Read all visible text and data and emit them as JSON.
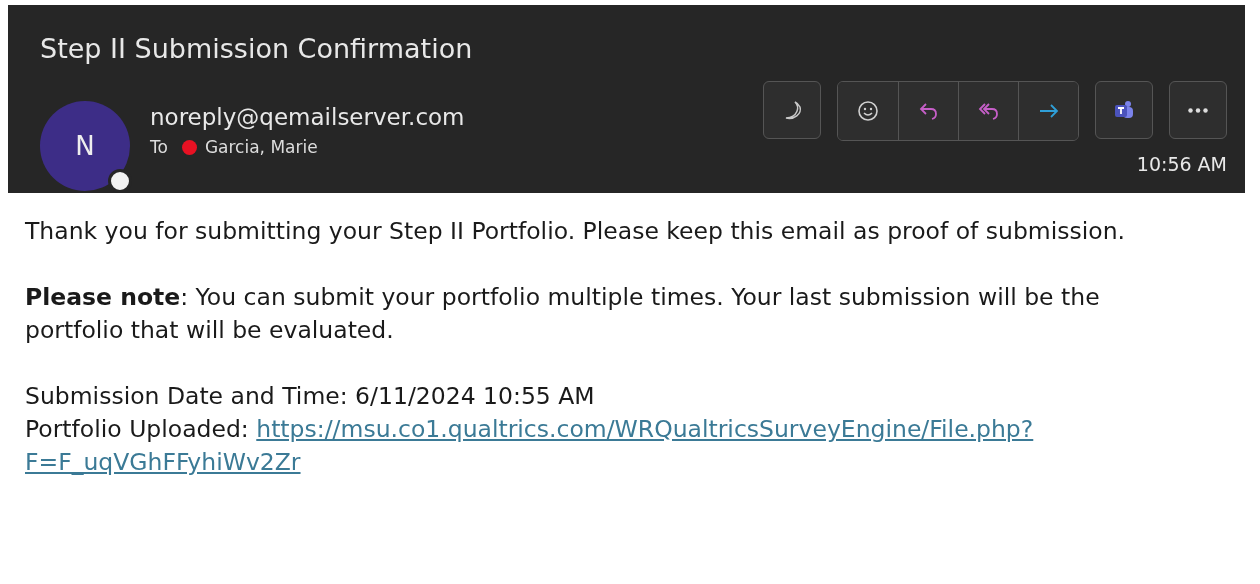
{
  "email": {
    "subject": "Step II Submission Confirmation",
    "sender": {
      "initial": "N",
      "address": "noreply@qemailserver.com"
    },
    "to_label": "To",
    "recipients": [
      {
        "name": "Garcia, Marie",
        "color": "#e81123"
      }
    ],
    "toolbar": [
      {
        "kind": "moon"
      },
      {
        "kind": "group",
        "items": [
          {
            "kind": "emoji"
          },
          {
            "kind": "reply"
          },
          {
            "kind": "reply-all"
          },
          {
            "kind": "forward"
          }
        ]
      },
      {
        "kind": "teams"
      },
      {
        "kind": "more"
      }
    ],
    "time": "10:56 AM"
  },
  "body": {
    "paragraphs": [
      "Thank you for submitting your Step II Portfolio. Please keep this email as proof of submission.",
      "**Please note**: You can submit your portfolio multiple times. Your last submission will be the portfolio that will be evaluated."
    ],
    "details": [
      "Submission Date and Time: 6/11/2024 10:55 AM"
    ],
    "upload_label": "Portfolio Uploaded:",
    "upload_link_lines": [
      "https://msu.co1.qualtrics.com/WRQualtricsSurveyEngine/File.php?",
      "F=F_uqVGhFFyhiWv2Zr"
    ]
  }
}
